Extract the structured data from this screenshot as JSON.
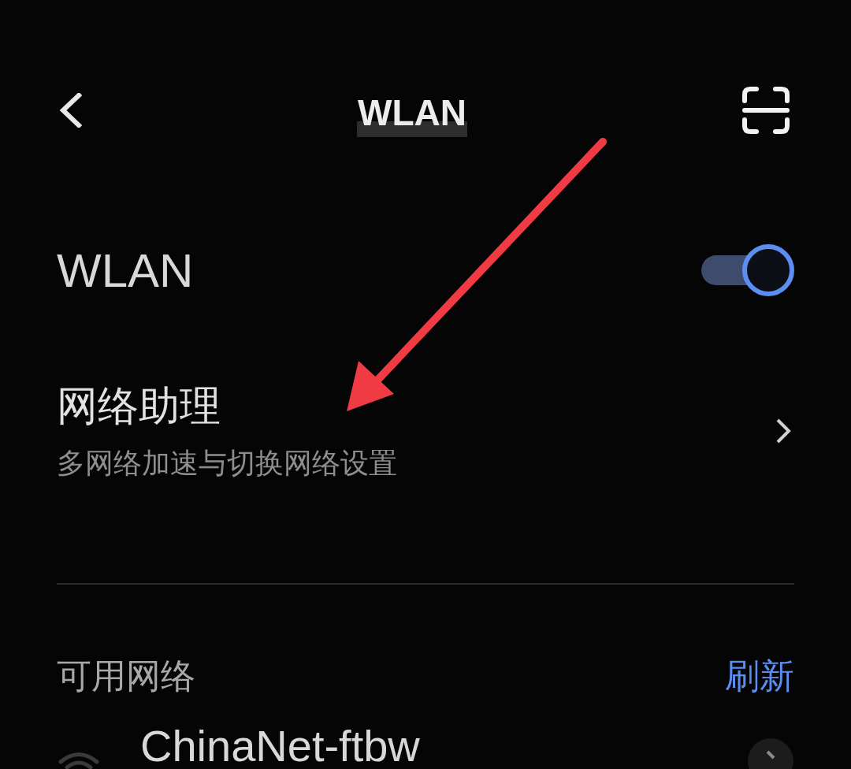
{
  "header": {
    "title": "WLAN"
  },
  "wlan": {
    "label": "WLAN",
    "on": true
  },
  "assistant": {
    "title": "网络助理",
    "subtitle": "多网络加速与切换网络设置"
  },
  "available": {
    "heading": "可用网络",
    "refresh": "刷新"
  },
  "networks": [
    {
      "name": "ChinaNet-ftbw"
    }
  ]
}
